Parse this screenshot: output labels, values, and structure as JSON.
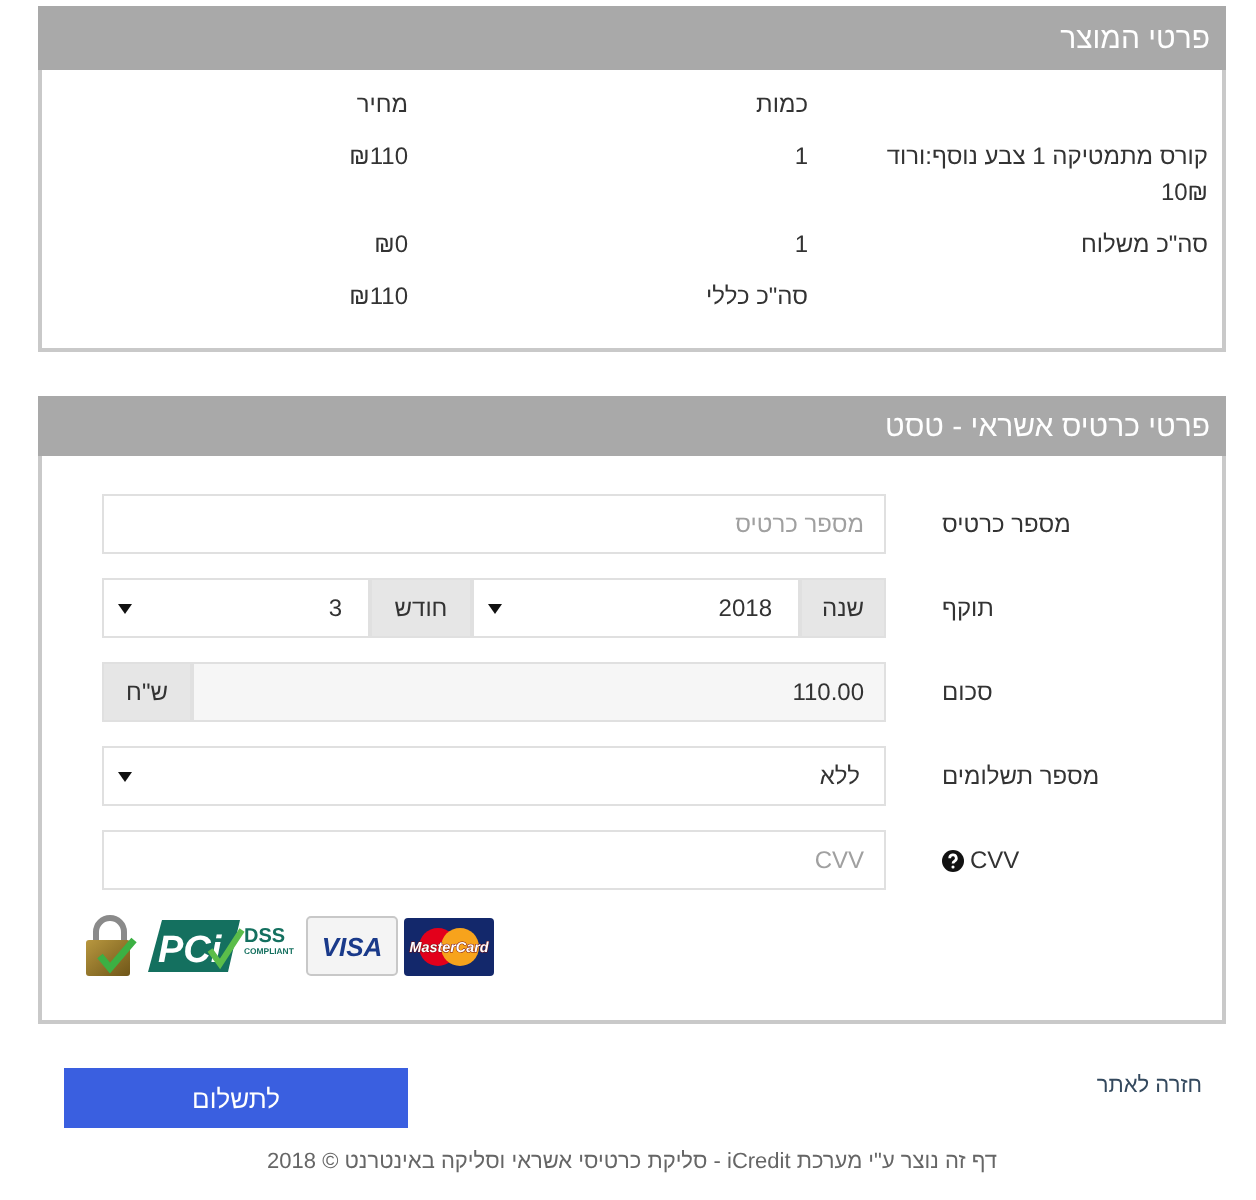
{
  "product_panel": {
    "title": "פרטי המוצר",
    "headers": {
      "quantity": "כמות",
      "price": "מחיר"
    },
    "rows": [
      {
        "item": "קורס מתמטיקה 1 צבע נוסף:ורוד 10₪",
        "quantity": "1",
        "price": "₪110"
      },
      {
        "item": "סה\"כ משלוח",
        "quantity": "1",
        "price": "₪0"
      }
    ],
    "total": {
      "label": "סה\"כ כללי",
      "price": "₪110"
    }
  },
  "payment_panel": {
    "title": "פרטי כרטיס אשראי - טסט",
    "fields": [
      {
        "kind": "text",
        "label": "מספר כרטיס",
        "placeholder": "מספר כרטיס"
      },
      {
        "kind": "expiry",
        "label": "תוקף",
        "year_label": "שנה",
        "year": "2018",
        "month_label": "חודש",
        "month": "3"
      },
      {
        "kind": "amount",
        "label": "סכום",
        "value": "110.00",
        "currency": "ש\"ח"
      },
      {
        "kind": "select",
        "label": "מספר תשלומים",
        "value": "ללא"
      },
      {
        "kind": "cvv",
        "label": "CVV",
        "placeholder": "CVV"
      }
    ],
    "badges": [
      {
        "kind": "mastercard",
        "text": "MasterCard"
      },
      {
        "kind": "visa",
        "text": "VISA"
      },
      {
        "kind": "pci",
        "text": "PCi",
        "title": "DSS",
        "subtitle": "COMPLIANT"
      },
      {
        "kind": "padlock"
      }
    ]
  },
  "back_link": "חזרה לאתר",
  "pay_button": "לתשלום",
  "footer": "דף זה נוצר ע\"י מערכת iCredit - סליקת כרטיסי אשראי וסליקה באינטרנט © 2018"
}
